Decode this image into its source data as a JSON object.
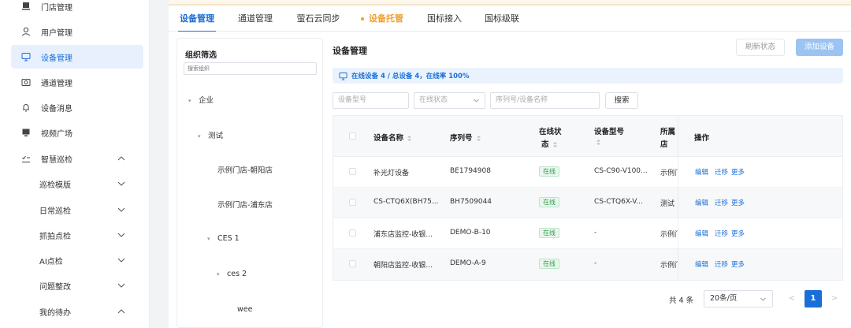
{
  "sidebar": {
    "items": [
      {
        "label": "门店管理",
        "icon": "store-icon"
      },
      {
        "label": "用户管理",
        "icon": "user-icon"
      },
      {
        "label": "设备管理",
        "icon": "monitor-icon",
        "active": true
      },
      {
        "label": "通道管理",
        "icon": "camera-icon"
      },
      {
        "label": "设备消息",
        "icon": "bell-icon"
      },
      {
        "label": "视频广场",
        "icon": "screen-icon"
      },
      {
        "label": "智慧巡检",
        "icon": "checklist-icon",
        "expanded": true
      }
    ],
    "subitems": [
      {
        "label": "巡检模版"
      },
      {
        "label": "日常巡检"
      },
      {
        "label": "抓拍点检"
      },
      {
        "label": "AI点检"
      },
      {
        "label": "问题整改"
      },
      {
        "label": "我的待办",
        "expanded": true
      }
    ]
  },
  "tabs": [
    {
      "label": "设备管理",
      "active": true
    },
    {
      "label": "通道管理"
    },
    {
      "label": "萤石云同步"
    },
    {
      "label": "设备托管",
      "highlight": true
    },
    {
      "label": "国标接入"
    },
    {
      "label": "国标级联"
    }
  ],
  "org_filter": {
    "title": "组织筛选",
    "search_placeholder": "搜索组织",
    "tree": [
      {
        "label": "企业",
        "expanded": true
      },
      {
        "label": "测试",
        "expanded": true
      },
      {
        "label": "示例门店-朝阳店"
      },
      {
        "label": "示例门店-浦东店"
      },
      {
        "label": "CES 1",
        "expanded": true
      },
      {
        "label": "ces 2",
        "expanded": true
      },
      {
        "label": "wee"
      }
    ]
  },
  "device_panel": {
    "title": "设备管理",
    "refresh_label": "刷新状态",
    "add_label": "添加设备",
    "info_text": "在线设备 4 / 总设备 4，在线率 100%",
    "filters": {
      "model_placeholder": "设备型号",
      "status_placeholder": "在线状态",
      "serial_placeholder": "序列号/设备名称",
      "search_label": "搜索"
    }
  },
  "table": {
    "columns": [
      "设备名称",
      "序列号",
      "在线状",
      "态",
      "设备型号",
      "号",
      "所属",
      "店",
      "操作"
    ],
    "rows": [
      {
        "name": "补光灯设备",
        "serial": "BE1794908",
        "status": "在线",
        "model": "CS-C90-V100...",
        "store": "示例门"
      },
      {
        "name": "CS-CTQ6X(BH75...",
        "serial": "BH7509044",
        "status": "在线",
        "model": "CS-CTQ6X-V...",
        "store": "测试"
      },
      {
        "name": "浦东店监控-收银...",
        "serial": "DEMO-B-10",
        "status": "在线",
        "model": "-",
        "store": "示例门"
      },
      {
        "name": "朝阳店监控-收银...",
        "serial": "DEMO-A-9",
        "status": "在线",
        "model": "-",
        "store": "示例门"
      }
    ],
    "actions": [
      "编辑",
      "迁移",
      "更多"
    ]
  },
  "pagination": {
    "total": "共 4 条",
    "page_size": "20条/页",
    "current_page": "1",
    "prev": "<",
    "next": ">"
  },
  "colors": {
    "accent": "#1a6ed8",
    "highlight": "#f0a030",
    "online": "#2e9b4c"
  }
}
